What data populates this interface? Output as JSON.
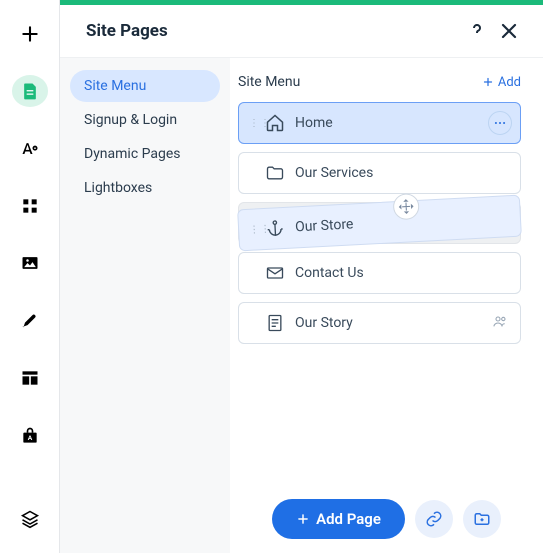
{
  "header": {
    "title": "Site Pages"
  },
  "nav": {
    "items": [
      {
        "label": "Site Menu"
      },
      {
        "label": "Signup & Login"
      },
      {
        "label": "Dynamic Pages"
      },
      {
        "label": "Lightboxes"
      }
    ]
  },
  "main": {
    "title": "Site Menu",
    "add_label": "Add",
    "pages": [
      {
        "label": "Home"
      },
      {
        "label": "Our Services"
      },
      {
        "label": "Our Store"
      },
      {
        "label": "Contact Us"
      },
      {
        "label": "Our Story"
      }
    ]
  },
  "footer": {
    "add_page_label": "Add Page"
  },
  "icons": {
    "plus": "plus-icon",
    "page": "page-icon",
    "font": "font-icon",
    "grid": "grid-icon",
    "image": "image-icon",
    "pen": "pen-icon",
    "layout": "layout-icon",
    "app": "app-icon",
    "layers": "layers-icon",
    "help": "help-icon",
    "close": "close-icon",
    "home": "home-icon",
    "folder": "folder-icon",
    "anchor": "anchor-icon",
    "mail": "mail-icon",
    "doc": "doc-icon",
    "members": "members-icon",
    "link": "link-icon",
    "folderplus": "folder-plus-icon",
    "move": "move-icon",
    "more": "more-icon"
  }
}
